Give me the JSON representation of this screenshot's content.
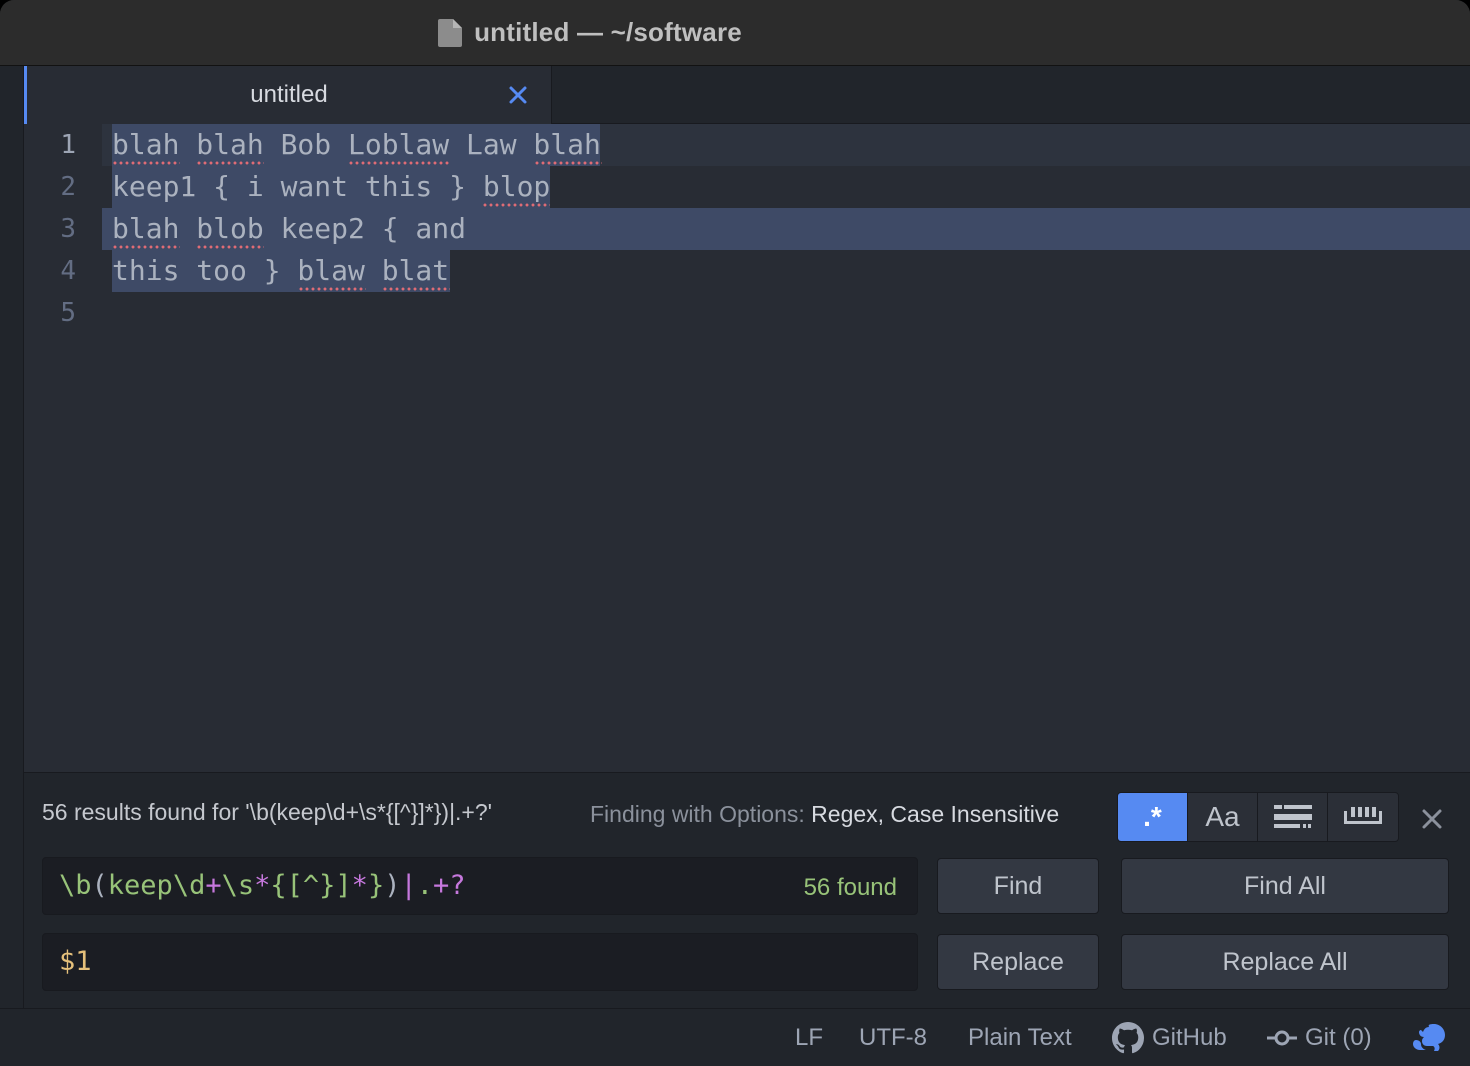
{
  "window": {
    "title": "untitled — ~/software"
  },
  "tab": {
    "title": "untitled"
  },
  "editor": {
    "line_numbers": [
      "1",
      "2",
      "3",
      "4",
      "5"
    ],
    "lines": [
      "blah blah Bob Loblaw Law blah",
      "keep1 { i want this } blop",
      "blah blob keep2 { and",
      "this too } blaw blat",
      ""
    ]
  },
  "find": {
    "status": "56 results found for '\\b(keep\\d+\\s*{[^}]*})|.+?'",
    "options_label": "Finding with Options:",
    "options_value": "Regex, Case Insensitive",
    "buttons": {
      "regex": ".*",
      "case": "Aa"
    },
    "query_tokens": [
      "\\b",
      "(",
      "keep",
      "\\d",
      "+",
      "\\s",
      "*",
      "{",
      "[^}]",
      "*",
      "}",
      ")",
      "|",
      ".",
      "+",
      "?"
    ],
    "found_count": "56 found",
    "replace_value": "$1",
    "find_label": "Find",
    "find_all_label": "Find All",
    "replace_label": "Replace",
    "replace_all_label": "Replace All"
  },
  "status": {
    "line_ending": "LF",
    "encoding": "UTF-8",
    "grammar": "Plain Text",
    "github": "GitHub",
    "git": "Git (0)"
  },
  "colors": {
    "accent": "#568af2",
    "selection": "#3e4a66",
    "regex_green": "#98c379",
    "regex_purple": "#c678dd",
    "spell_error": "#e06c75"
  }
}
